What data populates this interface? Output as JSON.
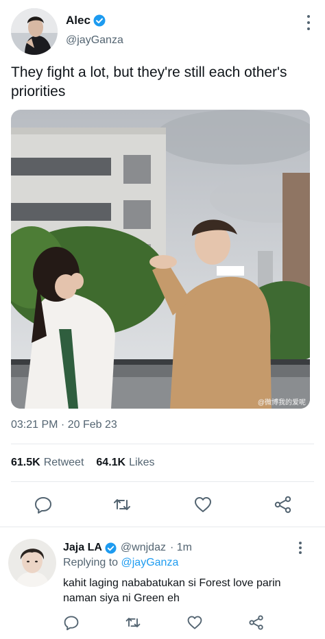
{
  "tweet": {
    "author_name": "Alec",
    "author_handle": "@jayGanza",
    "text": "They fight a lot, but they're still each other's priorities",
    "timestamp": "03:21 PM · 20 Feb 23",
    "watermark": "@微博我的爱呢",
    "retweets_count": "61.5K",
    "retweets_label": "Retweet",
    "likes_count": "64.1K",
    "likes_label": "Likes",
    "icons": [
      "verified-icon",
      "more-icon",
      "reply-icon",
      "retweet-icon",
      "like-icon",
      "share-icon"
    ]
  },
  "reply": {
    "author_name": "Jaja LA",
    "author_handle": "@wnjdaz",
    "age": "· 1m",
    "replying_prefix": "Replying to",
    "replying_to": "@jayGanza",
    "text": "kahit laging nababatukan si Forest love parin naman siya ni Green eh"
  },
  "colors": {
    "accent": "#1d9bf0",
    "secondary_text": "#536471",
    "divider": "#e6e9ec"
  }
}
